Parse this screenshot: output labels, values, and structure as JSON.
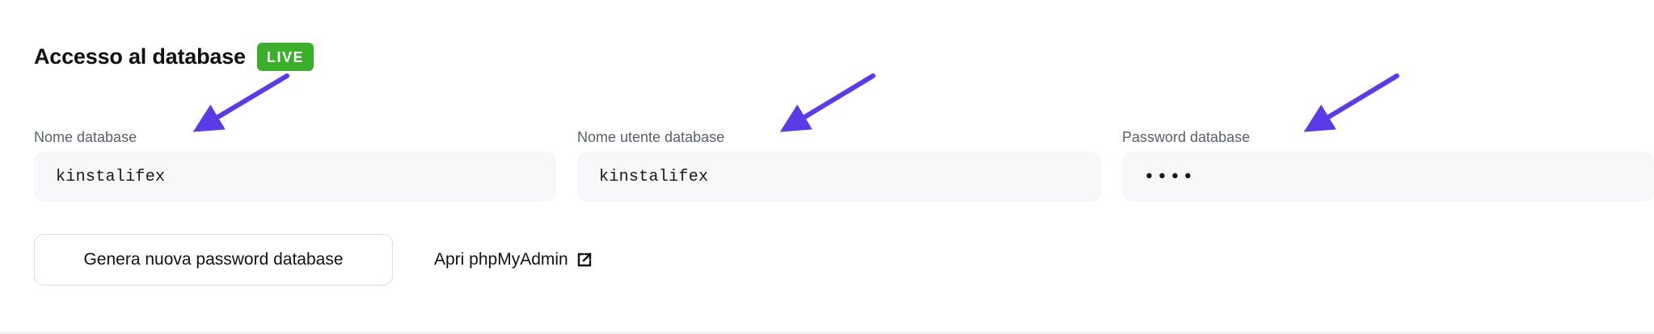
{
  "section": {
    "title": "Accesso al database",
    "badge": "LIVE",
    "badge_color": "#3ab02a"
  },
  "fields": [
    {
      "label": "Nome database",
      "value": "kinstalifex"
    },
    {
      "label": "Nome utente database",
      "value": "kinstalifex"
    },
    {
      "label": "Password database",
      "value": "••••"
    }
  ],
  "actions": {
    "generate_password_label": "Genera nuova password database",
    "phpmyadmin_label": "Apri phpMyAdmin",
    "phpmyadmin_icon": "external-link-icon"
  },
  "annotations": {
    "arrow_color": "#5b3be8",
    "arrow_icon": "arrow-pointer-icon"
  }
}
